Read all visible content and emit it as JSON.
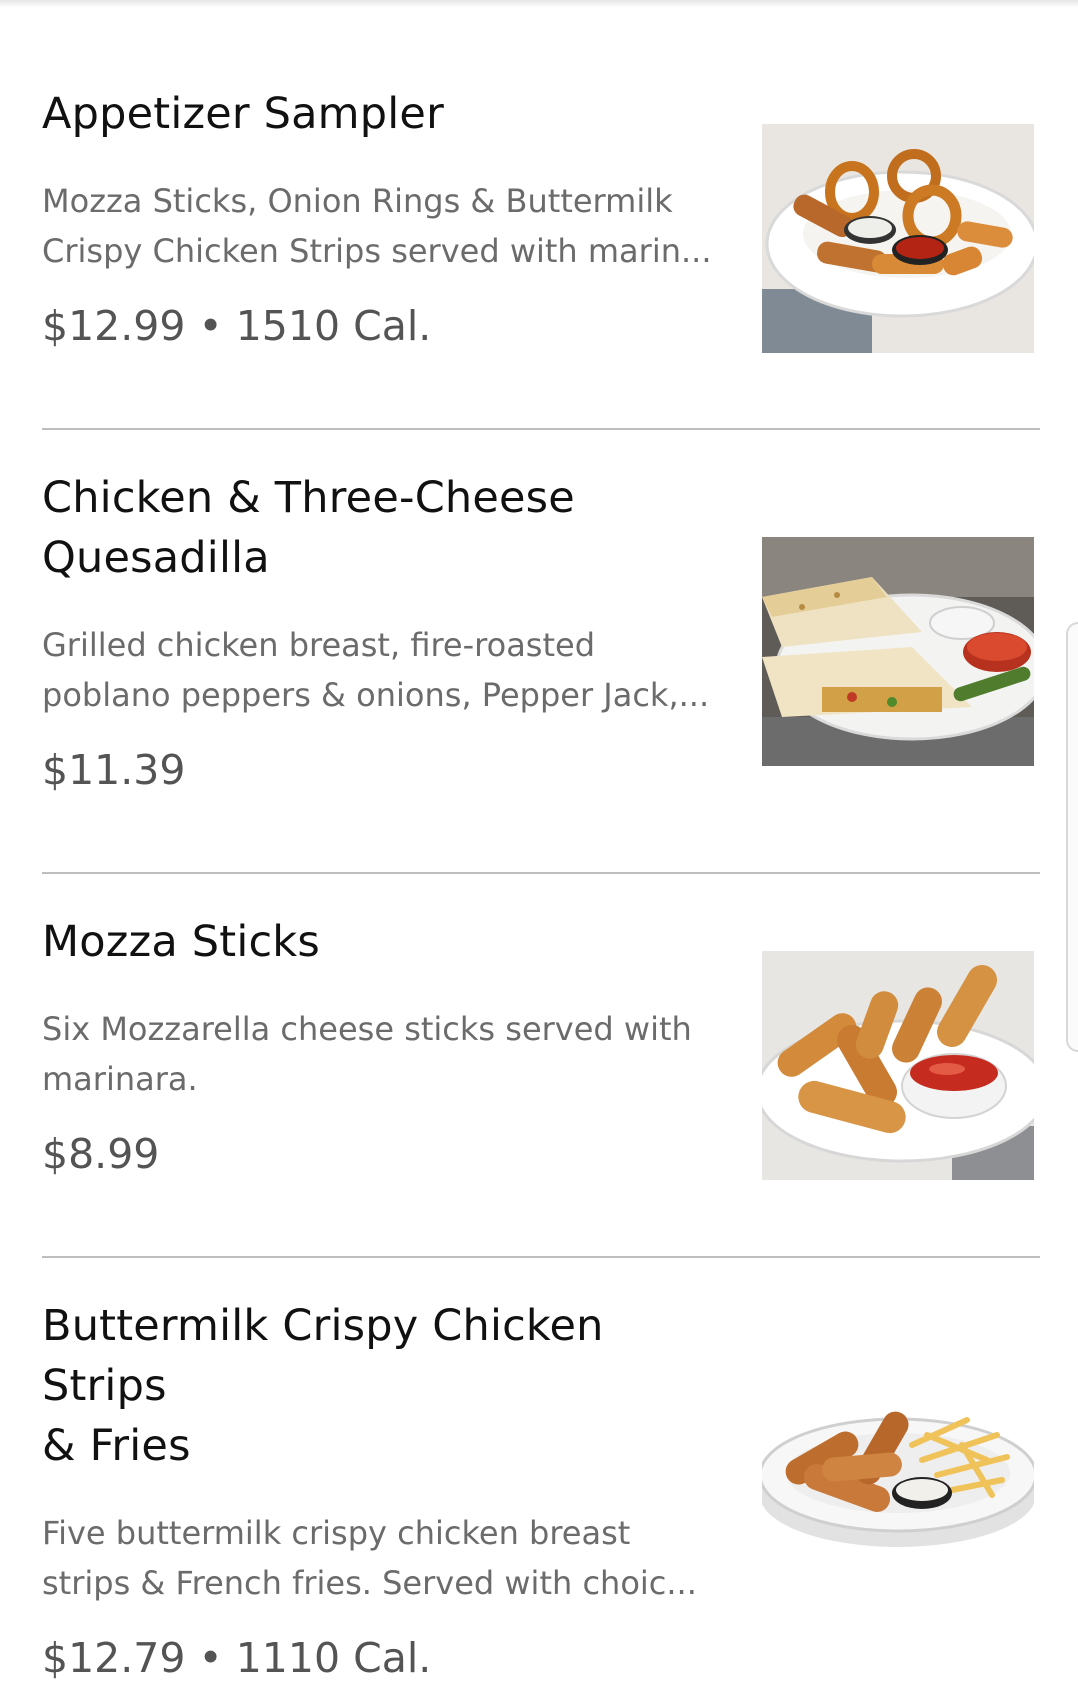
{
  "menu": {
    "items": [
      {
        "name": "Appetizer Sampler",
        "description_lines": [
          "Mozza Sticks, Onion Rings & Buttermilk",
          "Crispy Chicken Strips served with marin..."
        ],
        "price": "$12.99 • 1510 Cal.",
        "image": "appetizer-sampler-photo"
      },
      {
        "name_lines": [
          "Chicken & Three-Cheese",
          "Quesadilla"
        ],
        "description_lines": [
          "Grilled chicken breast, fire-roasted",
          "poblano peppers & onions, Pepper Jack,..."
        ],
        "price": "$11.39",
        "image": "quesadilla-photo"
      },
      {
        "name": "Mozza Sticks",
        "description_lines": [
          "Six Mozzarella cheese sticks served with",
          "marinara."
        ],
        "price": "$8.99",
        "image": "mozza-sticks-photo"
      },
      {
        "name_lines": [
          "Buttermilk Crispy Chicken Strips",
          "& Fries"
        ],
        "description_lines": [
          "Five buttermilk crispy chicken breast",
          "strips & French fries. Served with choic..."
        ],
        "price": "$12.79 • 1110 Cal.",
        "image": "chicken-strips-fries-photo"
      }
    ]
  }
}
